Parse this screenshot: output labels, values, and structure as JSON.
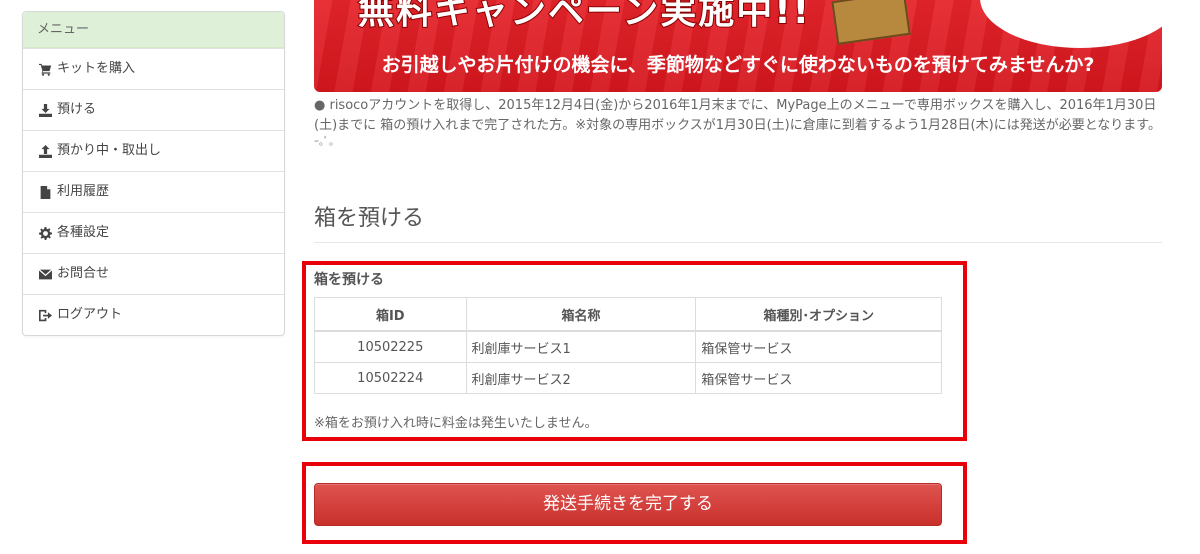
{
  "sidebar": {
    "heading": "メニュー",
    "items": [
      {
        "label": "キットを購入",
        "icon": "cart-icon"
      },
      {
        "label": "預ける",
        "icon": "download-icon"
      },
      {
        "label": "預かり中・取出し",
        "icon": "upload-icon"
      },
      {
        "label": "利用履歴",
        "icon": "file-icon"
      },
      {
        "label": "各種設定",
        "icon": "gear-icon"
      },
      {
        "label": "お問合せ",
        "icon": "envelope-icon"
      },
      {
        "label": "ログアウト",
        "icon": "logout-icon"
      }
    ]
  },
  "banner": {
    "headline": "無料キャンペーン実施中!!",
    "subline": "お引越しやお片付けの機会に、季節物などすぐに使わないものを預けてみませんか?"
  },
  "notice": "● risocoアカウントを取得し、2015年12月4日(金)から2016年1月末までに、MyPage上のメニューで専用ボックスを購入し、2016年1月30日(土)までに 箱の預け入れまで完了された方。※対象の専用ボックスが1月30日(土)に倉庫に到着するよう1月28日(木)には発送が必要となります。",
  "notice_tail": "ｰ｡ﾟ。",
  "section": {
    "title": "箱を預ける",
    "box_heading": "箱を預ける",
    "columns": [
      "箱ID",
      "箱名称",
      "箱種別･オプション"
    ],
    "rows": [
      {
        "id": "10502225",
        "name": "利創庫サービス1",
        "type": "箱保管サービス"
      },
      {
        "id": "10502224",
        "name": "利創庫サービス2",
        "type": "箱保管サービス"
      }
    ],
    "note": "※箱をお預け入れ時に料金は発生いたしません。",
    "complete_label": "発送手続きを完了する"
  },
  "colors": {
    "highlight": "#e8000b",
    "button": "#d9534f",
    "sidebar_head": "#dff0d8",
    "banner": "#e5242b"
  }
}
